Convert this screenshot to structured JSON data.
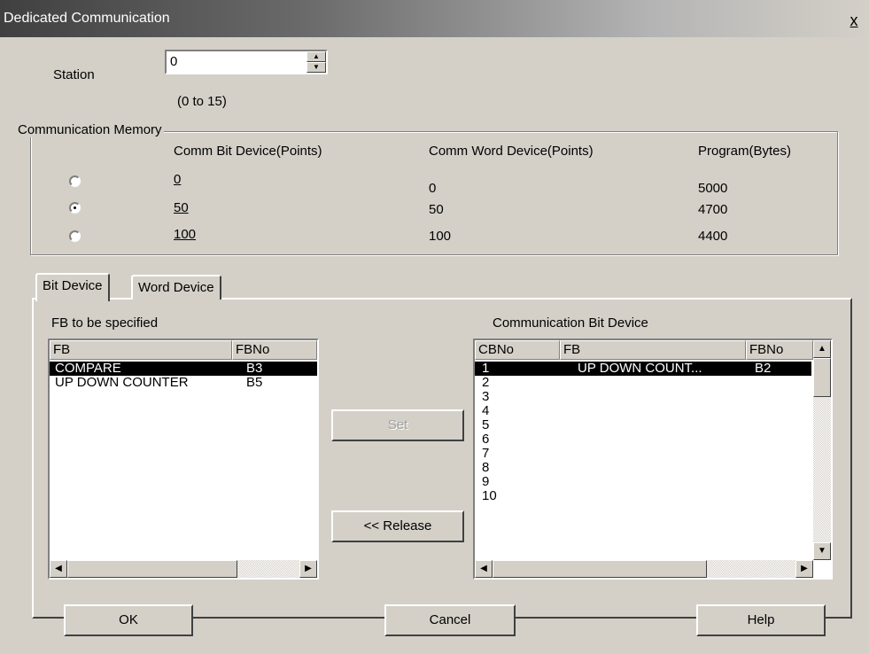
{
  "window": {
    "title": "Dedicated Communication",
    "close_label": "x"
  },
  "station": {
    "label": "Station",
    "value": "0",
    "range_hint": "(0 to 15)"
  },
  "comm_memory": {
    "legend": "Communication Memory",
    "headers": {
      "bit": "Comm Bit Device(Points)",
      "word": "Comm Word Device(Points)",
      "program": "Program(Bytes)"
    },
    "options": [
      {
        "bit": "0",
        "word": "0",
        "program": "5000",
        "selected": false
      },
      {
        "bit": "50",
        "word": "50",
        "program": "4700",
        "selected": true
      },
      {
        "bit": "100",
        "word": "100",
        "program": "4400",
        "selected": false
      }
    ]
  },
  "tabs": [
    {
      "label": "Bit Device",
      "active": true
    },
    {
      "label": "Word Device",
      "active": false
    }
  ],
  "fb_list": {
    "label": "FB to be specified",
    "columns": [
      "FB",
      "FBNo"
    ],
    "rows": [
      {
        "fb": "COMPARE",
        "fbno": "B3",
        "selected": true
      },
      {
        "fb": "UP DOWN COUNTER",
        "fbno": "B5",
        "selected": false
      }
    ]
  },
  "comm_list": {
    "label": "Communication Bit Device",
    "columns": [
      "CBNo",
      "FB",
      "FBNo"
    ],
    "rows": [
      {
        "cbno": "1",
        "fb": "UP DOWN COUNT...",
        "fbno": "B2",
        "selected": true
      },
      {
        "cbno": "2",
        "fb": "",
        "fbno": ""
      },
      {
        "cbno": "3",
        "fb": "",
        "fbno": ""
      },
      {
        "cbno": "4",
        "fb": "",
        "fbno": ""
      },
      {
        "cbno": "5",
        "fb": "",
        "fbno": ""
      },
      {
        "cbno": "6",
        "fb": "",
        "fbno": ""
      },
      {
        "cbno": "7",
        "fb": "",
        "fbno": ""
      },
      {
        "cbno": "8",
        "fb": "",
        "fbno": ""
      },
      {
        "cbno": "9",
        "fb": "",
        "fbno": ""
      },
      {
        "cbno": "10",
        "fb": "",
        "fbno": ""
      }
    ]
  },
  "buttons": {
    "set": "Set",
    "release": "<< Release",
    "ok": "OK",
    "cancel": "Cancel",
    "help": "Help"
  }
}
